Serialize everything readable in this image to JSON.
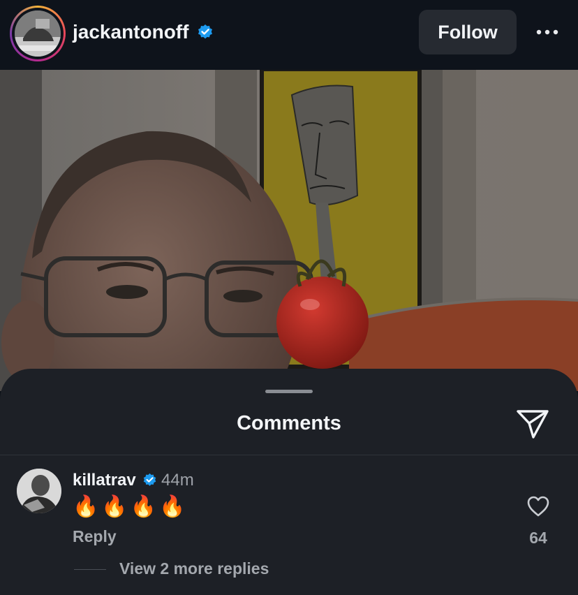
{
  "header": {
    "username": "jackantonoff",
    "follow_label": "Follow",
    "more_icon": "more-horizontal-icon",
    "verified_icon": "verified-badge-icon",
    "story_ring_colors": [
      "#f5b43a",
      "#e8465a",
      "#b32a8e"
    ]
  },
  "sheet": {
    "title": "Comments",
    "share_icon": "send-icon"
  },
  "comments": [
    {
      "username": "killatrav",
      "verified": true,
      "time": "44m",
      "text": "🔥🔥🔥🔥",
      "reply_label": "Reply",
      "likes": "64",
      "view_replies_label": "View 2 more replies"
    }
  ],
  "colors": {
    "sheet_bg": "#1d2026",
    "header_bg": "#0e131b",
    "verified_blue": "#1d9bf0",
    "secondary_text": "#a4a8ae"
  }
}
